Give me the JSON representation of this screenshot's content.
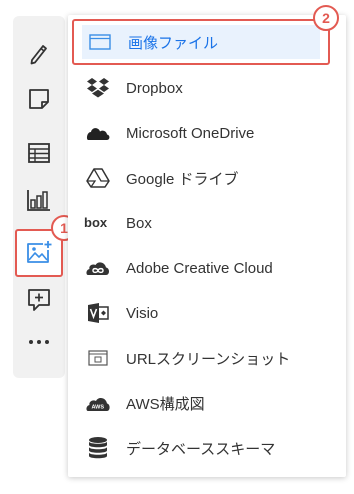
{
  "toolbar": {
    "tools": [
      {
        "name": "pencil-icon"
      },
      {
        "name": "sticky-note-icon"
      },
      {
        "name": "table-icon"
      },
      {
        "name": "chart-icon"
      },
      {
        "name": "image-plus-icon",
        "selected": true
      },
      {
        "name": "comment-plus-icon"
      },
      {
        "name": "more-icon"
      }
    ]
  },
  "callouts": {
    "one": "1",
    "two": "2"
  },
  "menu": {
    "items": [
      {
        "label": "画像ファイル",
        "icon": "image-file-icon",
        "selected": true
      },
      {
        "label": "Dropbox",
        "icon": "dropbox-icon"
      },
      {
        "label": "Microsoft OneDrive",
        "icon": "onedrive-icon"
      },
      {
        "label": "Google ドライブ",
        "icon": "google-drive-icon"
      },
      {
        "label": "Box",
        "icon": "box-icon"
      },
      {
        "label": "Adobe Creative Cloud",
        "icon": "creative-cloud-icon"
      },
      {
        "label": "Visio",
        "icon": "visio-icon"
      },
      {
        "label": "URLスクリーンショット",
        "icon": "url-screenshot-icon"
      },
      {
        "label": "AWS構成図",
        "icon": "aws-icon"
      },
      {
        "label": "データベーススキーマ",
        "icon": "database-icon"
      }
    ]
  },
  "colors": {
    "accent_red": "#e35a52",
    "selected_text": "#1a73e8",
    "selected_bg": "#e9f2fd",
    "toolbar_bg": "#f1f1f1"
  }
}
